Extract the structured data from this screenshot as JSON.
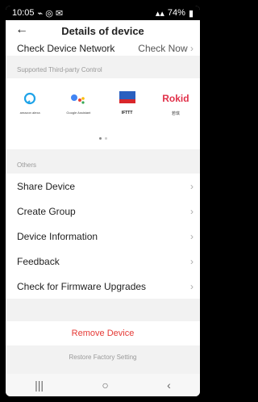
{
  "status": {
    "time": "10:05",
    "battery": "74%"
  },
  "header": {
    "back_icon": "back-arrow-icon",
    "title": "Details of device"
  },
  "network": {
    "label": "Check Device Network",
    "action": "Check Now"
  },
  "third_party": {
    "section_title": "Supported Third-party Control",
    "items": [
      {
        "name": "amazon alexa",
        "icon": "alexa-icon"
      },
      {
        "name": "Google Assistant",
        "icon": "google-assistant-icon"
      },
      {
        "name": "IFTTT",
        "icon": "ifttt-icon"
      },
      {
        "name": "Rokid",
        "subtitle": "若琪",
        "icon": "rokid-icon"
      }
    ]
  },
  "others": {
    "section_title": "Others",
    "items": [
      {
        "label": "Share Device"
      },
      {
        "label": "Create Group"
      },
      {
        "label": "Device Information"
      },
      {
        "label": "Feedback"
      },
      {
        "label": "Check for Firmware Upgrades"
      }
    ]
  },
  "actions": {
    "remove": "Remove Device",
    "restore": "Restore Factory Setting"
  },
  "colors": {
    "remove": "#e53935",
    "background": "#f2f2f2"
  }
}
